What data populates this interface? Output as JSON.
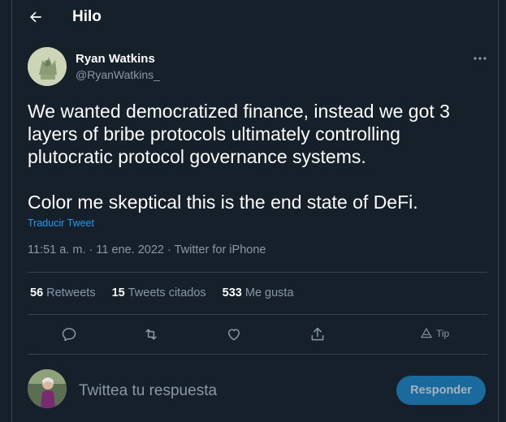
{
  "header": {
    "title": "Hilo"
  },
  "tweet": {
    "author_name": "Ryan Watkins",
    "author_handle": "@RyanWatkins_",
    "text": "We wanted democratized finance, instead we got 3 layers of bribe protocols ultimately controlling plutocratic protocol governance systems.\n\nColor me skeptical this is the end state of DeFi.",
    "translate_label": "Traducir Tweet",
    "time": "11:51 a. m.",
    "date": "11 ene. 2022",
    "separator": "·",
    "source": "Twitter for iPhone"
  },
  "stats": [
    {
      "count": "56",
      "label": "Retweets"
    },
    {
      "count": "15",
      "label": "Tweets citados"
    },
    {
      "count": "533",
      "label": "Me gusta"
    }
  ],
  "actions": {
    "icons": [
      "reply-icon",
      "retweet-icon",
      "like-icon",
      "share-icon",
      "tip-icon"
    ],
    "tip_label": "Tip"
  },
  "reply": {
    "placeholder": "Twittea tu respuesta",
    "button_label": "Responder"
  },
  "colors": {
    "background": "#15202b",
    "border": "#38444d",
    "secondary_text": "#8899a6",
    "accent": "#1d9bf0",
    "button_disabled": "#1a6a9e"
  }
}
